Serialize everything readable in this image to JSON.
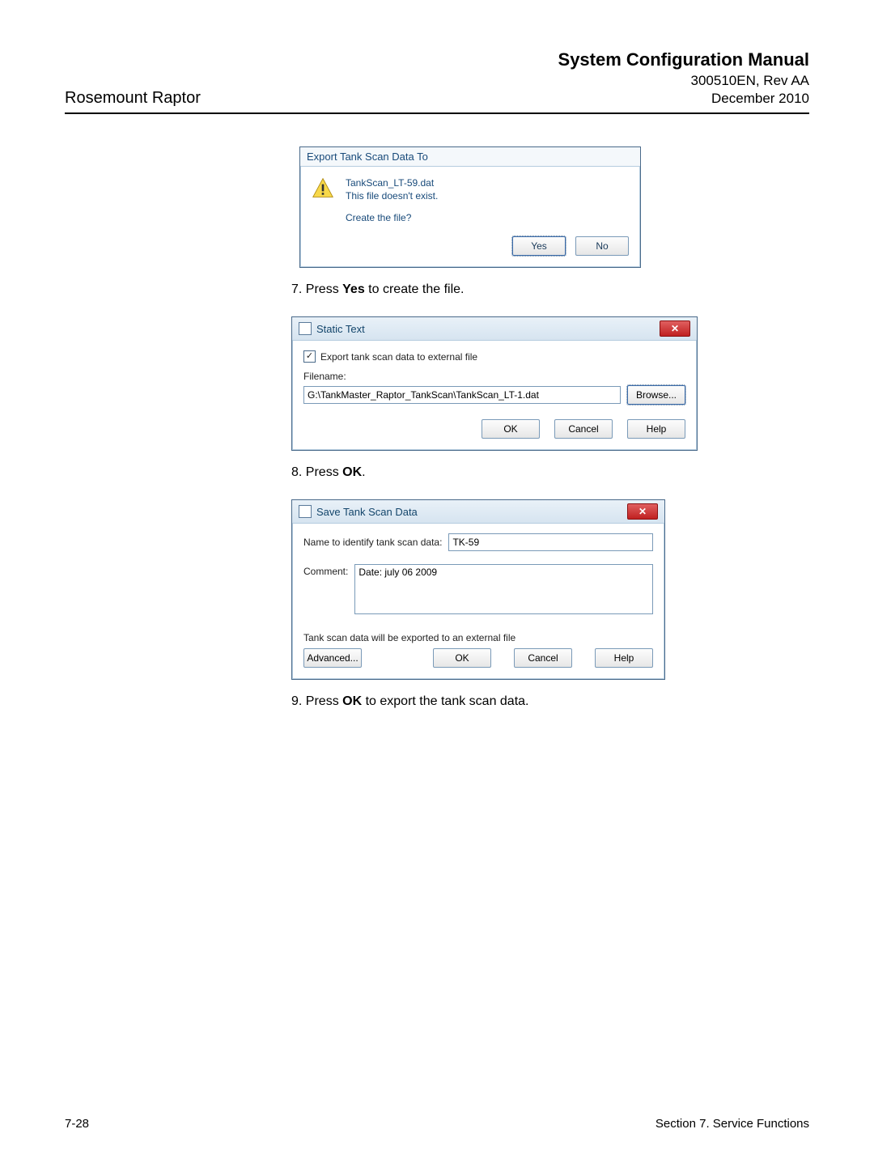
{
  "header": {
    "product": "Rosemount Raptor",
    "title": "System Configuration Manual",
    "docnum": "300510EN, Rev AA",
    "date": "December 2010"
  },
  "steps": {
    "s7_pre": "7. Press ",
    "s7_bold": "Yes",
    "s7_post": " to create the file.",
    "s8_pre": "8. Press ",
    "s8_bold": "OK",
    "s8_post": ".",
    "s9_pre": "9. Press ",
    "s9_bold": "OK",
    "s9_post": " to export the tank scan data."
  },
  "dlg1": {
    "title": "Export Tank Scan Data To",
    "line1": "TankScan_LT-59.dat",
    "line2": "This file doesn't exist.",
    "question": "Create the file?",
    "yes": "Yes",
    "no": "No"
  },
  "dlg2": {
    "title": "Static Text",
    "chk_label": "Export tank scan data to external file",
    "filename_label": "Filename:",
    "filename_value": "G:\\TankMaster_Raptor_TankScan\\TankScan_LT-1.dat",
    "browse": "Browse...",
    "ok": "OK",
    "cancel": "Cancel",
    "help": "Help"
  },
  "dlg3": {
    "title": "Save Tank Scan Data",
    "name_label": "Name to identify tank scan data:",
    "name_value": "TK-59",
    "comment_label": "Comment:",
    "comment_value": "Date: july 06 2009",
    "note": "Tank scan data will be exported to an external file",
    "advanced": "Advanced...",
    "ok": "OK",
    "cancel": "Cancel",
    "help": "Help"
  },
  "footer": {
    "left": "7-28",
    "right": "Section 7. Service Functions"
  }
}
